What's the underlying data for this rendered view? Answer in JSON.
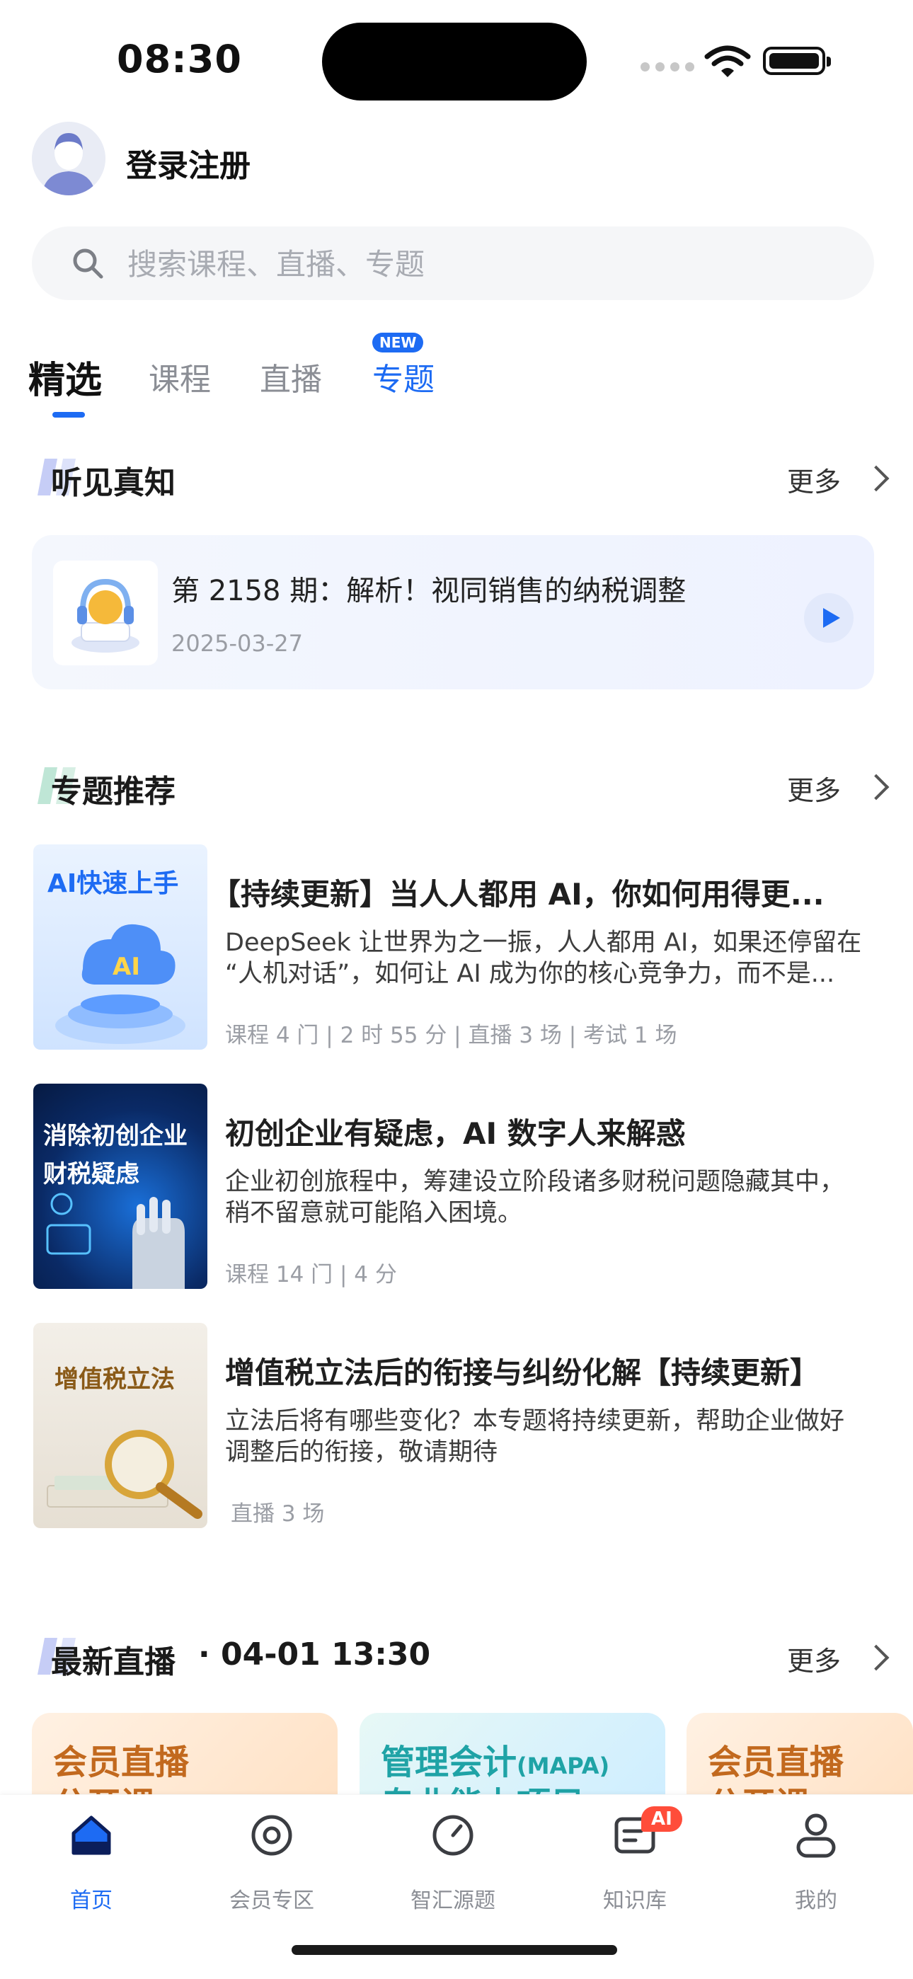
{
  "status_bar": {
    "time": "08:30"
  },
  "header": {
    "login_label": "登录注册"
  },
  "search": {
    "placeholder": "搜索课程、直播、专题"
  },
  "tabs": [
    {
      "label": "精选",
      "active": true
    },
    {
      "label": "课程"
    },
    {
      "label": "直播"
    },
    {
      "label": "专题",
      "badge": "NEW"
    }
  ],
  "podcast_section": {
    "title": "听见真知",
    "more_label": "更多",
    "item": {
      "title": "第 2158 期：解析！视同销售的纳税调整",
      "date": "2025-03-27"
    }
  },
  "topics_section": {
    "title": "专题推荐",
    "more_label": "更多",
    "items": [
      {
        "thumb_text": "AI快速上手",
        "title": "【持续更新】当人人都用 AI，你如何用得更...",
        "desc_line1": "DeepSeek 让世界为之一振，人人都用 AI，如果还停留在",
        "desc_line2": "“人机对话”，如何让 AI 成为你的核心竞争力，而不是...",
        "meta": "课程 4 门 | 2 时 55 分 |  直播 3 场 |  考试 1 场"
      },
      {
        "thumb_text_1": "消除初创企业",
        "thumb_text_2": "财税疑虑",
        "title": "初创企业有疑虑，AI 数字人来解惑",
        "desc_line1": "企业初创旅程中，筹建设立阶段诸多财税问题隐藏其中，",
        "desc_line2": "稍不留意就可能陷入困境。",
        "meta": "课程 14 门 | 4 分"
      },
      {
        "thumb_text": "增值税立法",
        "title": "增值税立法后的衔接与纠纷化解【持续更新】",
        "desc_line1": "立法后将有哪些变化？本专题将持续更新，帮助企业做好",
        "desc_line2": "调整后的衔接，敬请期待",
        "meta": "直播 3 场"
      }
    ]
  },
  "live_section": {
    "title": "最新直播",
    "datetime": "· 04-01 13:30",
    "more_label": "更多",
    "cards": [
      {
        "line1": "会员直播",
        "line2": "公开课"
      },
      {
        "line1": "管理会计",
        "line1_sub": "(MAPA)",
        "line2": "专业能力项目"
      },
      {
        "line1": "会员直播",
        "line2": "公开课"
      }
    ]
  },
  "tabbar": {
    "items": [
      {
        "label": "首页",
        "icon": "home-icon",
        "active": true
      },
      {
        "label": "会员专区",
        "icon": "target-icon"
      },
      {
        "label": "智汇源题",
        "icon": "compass-icon"
      },
      {
        "label": "知识库",
        "icon": "notebook-icon",
        "badge": "AI"
      },
      {
        "label": "我的",
        "icon": "person-icon"
      }
    ]
  },
  "colors": {
    "accent": "#1d6bf3",
    "badge_red": "#ff4d3a"
  }
}
